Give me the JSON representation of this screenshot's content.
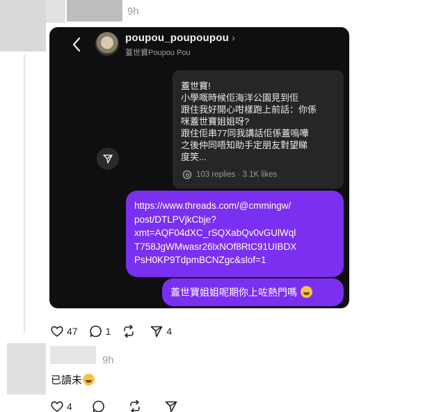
{
  "post": {
    "timestamp": "9h",
    "dm_screenshot": {
      "chat_name": "poupou_poupoupou",
      "chat_subname": "蓋世寶Poupou Pou",
      "shared_post_text": "蓋世寶!\n小學嘅時候佢海洋公園見到佢\n跟住我好開心咁樣跑上前話：你係\n咪蓋世寶姐姐呀?\n跟住佢串77同我講話佢係蓋嗚嘩\n之後仲同唔知助手定朋友對望睇\n度笑...",
      "shared_post_stats": "103 replies · 3.1K likes",
      "link_message": "https://www.threads.com/@cmmingw/\npost/DTLPVjkCbje?\nxmt=AQF04dXC_rSQXabQv0vGUlWql\nT758JgWMwasr26lxNOf8RtC91UIBDX\nPsH0KP9TdpmBCNZgc&slof=1",
      "reply_message": "蓋世寶姐姐呢期你上咗熱門嗎"
    },
    "actions": {
      "likes": "47",
      "comments": "1",
      "reposts": "",
      "shares": "4"
    }
  },
  "reply": {
    "timestamp": "9h",
    "text": "已讀未",
    "actions": {
      "likes": "4",
      "comments": "",
      "reposts": "",
      "shares": ""
    }
  },
  "colors": {
    "bubble": "#7b2ff0",
    "card_bg": "#0f0f12",
    "muted": "#999999"
  }
}
